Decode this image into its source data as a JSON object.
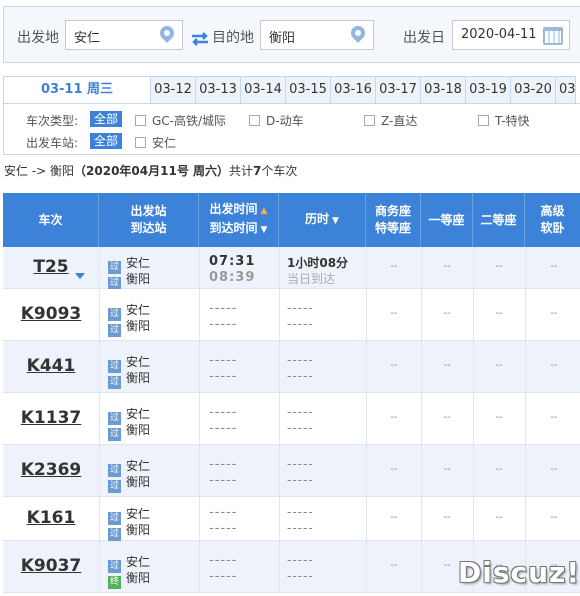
{
  "search": {
    "from_label": "出发地",
    "from_value": "安仁",
    "to_label": "目的地",
    "to_value": "衡阳",
    "date_label": "出发日",
    "date_value": "2020-04-11",
    "from_icon": "location-pin-icon",
    "to_icon": "location-pin-icon",
    "swap_icon": "swap-arrows-icon",
    "date_icon": "calendar-icon"
  },
  "date_tabs": [
    {
      "label": "03-11 周三",
      "active": true
    },
    {
      "label": "03-12"
    },
    {
      "label": "03-13"
    },
    {
      "label": "03-14"
    },
    {
      "label": "03-15"
    },
    {
      "label": "03-16"
    },
    {
      "label": "03-17"
    },
    {
      "label": "03-18"
    },
    {
      "label": "03-19"
    },
    {
      "label": "03-20"
    },
    {
      "label": "03-"
    }
  ],
  "filters": {
    "type_label": "车次类型:",
    "type_all": "全部",
    "type_options": [
      "GC-高铁/城际",
      "D-动车",
      "Z-直达",
      "T-特快"
    ],
    "station_label": "出发车站:",
    "station_all": "全部",
    "station_options": [
      "安仁"
    ]
  },
  "summary": {
    "route": "安仁 -> 衡阳",
    "date": "（2020年04月11号 周六）",
    "count_prefix": "共计",
    "count": "7",
    "count_suffix": "个车次"
  },
  "table": {
    "headers": {
      "train": "车次",
      "station_top": "出发站",
      "station_bottom": "到达站",
      "time_top": "出发时间",
      "time_bottom": "到达时间",
      "duration": "历时",
      "business_top": "商务座",
      "business_bottom": "特等座",
      "first_class": "一等座",
      "second_class": "二等座",
      "soft_top": "高级",
      "soft_bottom": "软卧"
    },
    "pass_tag": "过",
    "end_tag": "终",
    "rows": [
      {
        "train": "T25",
        "from": "安仁",
        "to": "衡阳",
        "dep": "07:31",
        "arr": "08:39",
        "duration": "1小时08分",
        "arrive_note": "当日到达",
        "seats": [
          "--",
          "--",
          "--",
          "--"
        ]
      },
      {
        "train": "K9093",
        "from": "安仁",
        "to": "衡阳",
        "dep": "-----",
        "arr": "-----",
        "duration": "-----",
        "arrive_note": "-----",
        "seats": [
          "--",
          "--",
          "--",
          "--"
        ]
      },
      {
        "train": "K441",
        "from": "安仁",
        "to": "衡阳",
        "dep": "-----",
        "arr": "-----",
        "duration": "-----",
        "arrive_note": "-----",
        "seats": [
          "--",
          "--",
          "--",
          "--"
        ]
      },
      {
        "train": "K1137",
        "from": "安仁",
        "to": "衡阳",
        "dep": "-----",
        "arr": "-----",
        "duration": "-----",
        "arrive_note": "-----",
        "seats": [
          "--",
          "--",
          "--",
          "--"
        ]
      },
      {
        "train": "K2369",
        "from": "安仁",
        "to": "衡阳",
        "dep": "-----",
        "arr": "-----",
        "duration": "-----",
        "arrive_note": "-----",
        "seats": [
          "--",
          "--",
          "--",
          "--"
        ]
      },
      {
        "train": "K161",
        "from": "安仁",
        "to": "衡阳",
        "dep": "-----",
        "arr": "-----",
        "duration": "-----",
        "arrive_note": "-----",
        "seats": [
          "--",
          "--",
          "--",
          "--"
        ]
      },
      {
        "train": "K9037",
        "from": "安仁",
        "to": "衡阳",
        "dep": "-----",
        "arr": "-----",
        "duration": "-----",
        "arrive_note": "-----",
        "seats": [
          "--",
          "--",
          "--",
          "--"
        ]
      }
    ]
  },
  "watermark": "Discuz!",
  "colors": {
    "accent": "#3b82d8",
    "sort_arrow": "#ffa94d",
    "pass_tag": "#6c9bd2",
    "end_tag": "#55b05b"
  }
}
